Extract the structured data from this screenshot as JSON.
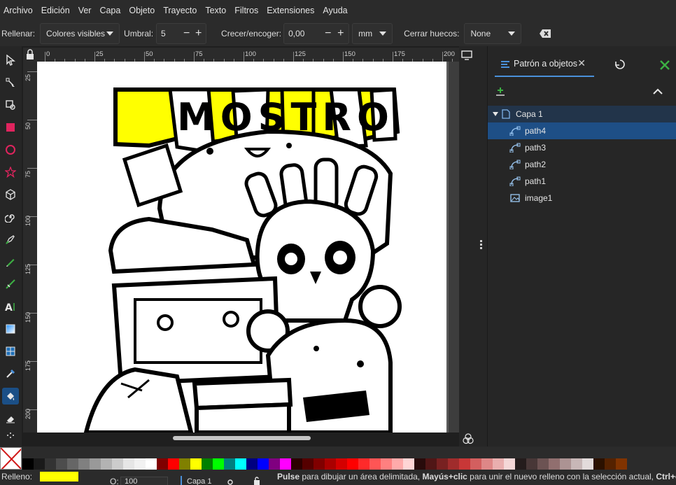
{
  "menu": [
    "Archivo",
    "Edición",
    "Ver",
    "Capa",
    "Objeto",
    "Trayecto",
    "Texto",
    "Filtros",
    "Extensiones",
    "Ayuda"
  ],
  "tool_options": {
    "fill_label": "Rellenar:",
    "fill_value": "Colores visibles",
    "threshold_label": "Umbral:",
    "threshold_value": "5",
    "grow_label": "Crecer/encoger:",
    "grow_value": "0,00",
    "unit_value": "mm",
    "close_gaps_label": "Cerrar huecos:",
    "close_gaps_value": "None"
  },
  "ruler_h": [
    "0",
    "25",
    "50",
    "75",
    "100",
    "125",
    "150",
    "175",
    "200"
  ],
  "ruler_v": [
    "25",
    "50",
    "75",
    "100",
    "125",
    "150",
    "175",
    "200"
  ],
  "artwork_text": "MOSTRO",
  "panel": {
    "tab_label": "Patrón a objetos",
    "tree": [
      {
        "label": "Capa 1",
        "kind": "layer"
      },
      {
        "label": "path4",
        "kind": "path",
        "selected": true
      },
      {
        "label": "path3",
        "kind": "path"
      },
      {
        "label": "path2",
        "kind": "path"
      },
      {
        "label": "path1",
        "kind": "path"
      },
      {
        "label": "image1",
        "kind": "image"
      }
    ]
  },
  "palette_colors": [
    "#000000",
    "#1a1a1a",
    "#333333",
    "#4d4d4d",
    "#666666",
    "#808080",
    "#999999",
    "#b3b3b3",
    "#cccccc",
    "#e6e6e6",
    "#f2f2f2",
    "#ffffff",
    "#800000",
    "#ff0000",
    "#808000",
    "#ffff00",
    "#008000",
    "#00ff00",
    "#008080",
    "#00ffff",
    "#000080",
    "#0000ff",
    "#800080",
    "#ff00ff",
    "#2b0000",
    "#550000",
    "#800000",
    "#aa0000",
    "#d40000",
    "#ff0000",
    "#ff2a2a",
    "#ff5555",
    "#ff8080",
    "#ffaaaa",
    "#ffd5d5",
    "#280b0b",
    "#501616",
    "#782121",
    "#a02c2c",
    "#c83737",
    "#d35f5f",
    "#de8787",
    "#e9afaf",
    "#f4d7d7",
    "#241c1c",
    "#483737",
    "#6c5353",
    "#916f6f",
    "#ac9393",
    "#c8b7b7",
    "#e3dbdb",
    "#2b1100",
    "#552200",
    "#803300"
  ],
  "status": {
    "fill_label": "Relleno:",
    "fill_color": "#ffff00",
    "opacity_label": "O:",
    "opacity_value": "100",
    "layer_label": "Capa 1",
    "msg_bold1": "Pulse",
    "msg_1": " para dibujar un área delimitada, ",
    "msg_bold2": "Mayús+clic",
    "msg_2": " para unir el nuevo relleno con la selección actual, ",
    "msg_bold3": "Ctrl+clic"
  }
}
